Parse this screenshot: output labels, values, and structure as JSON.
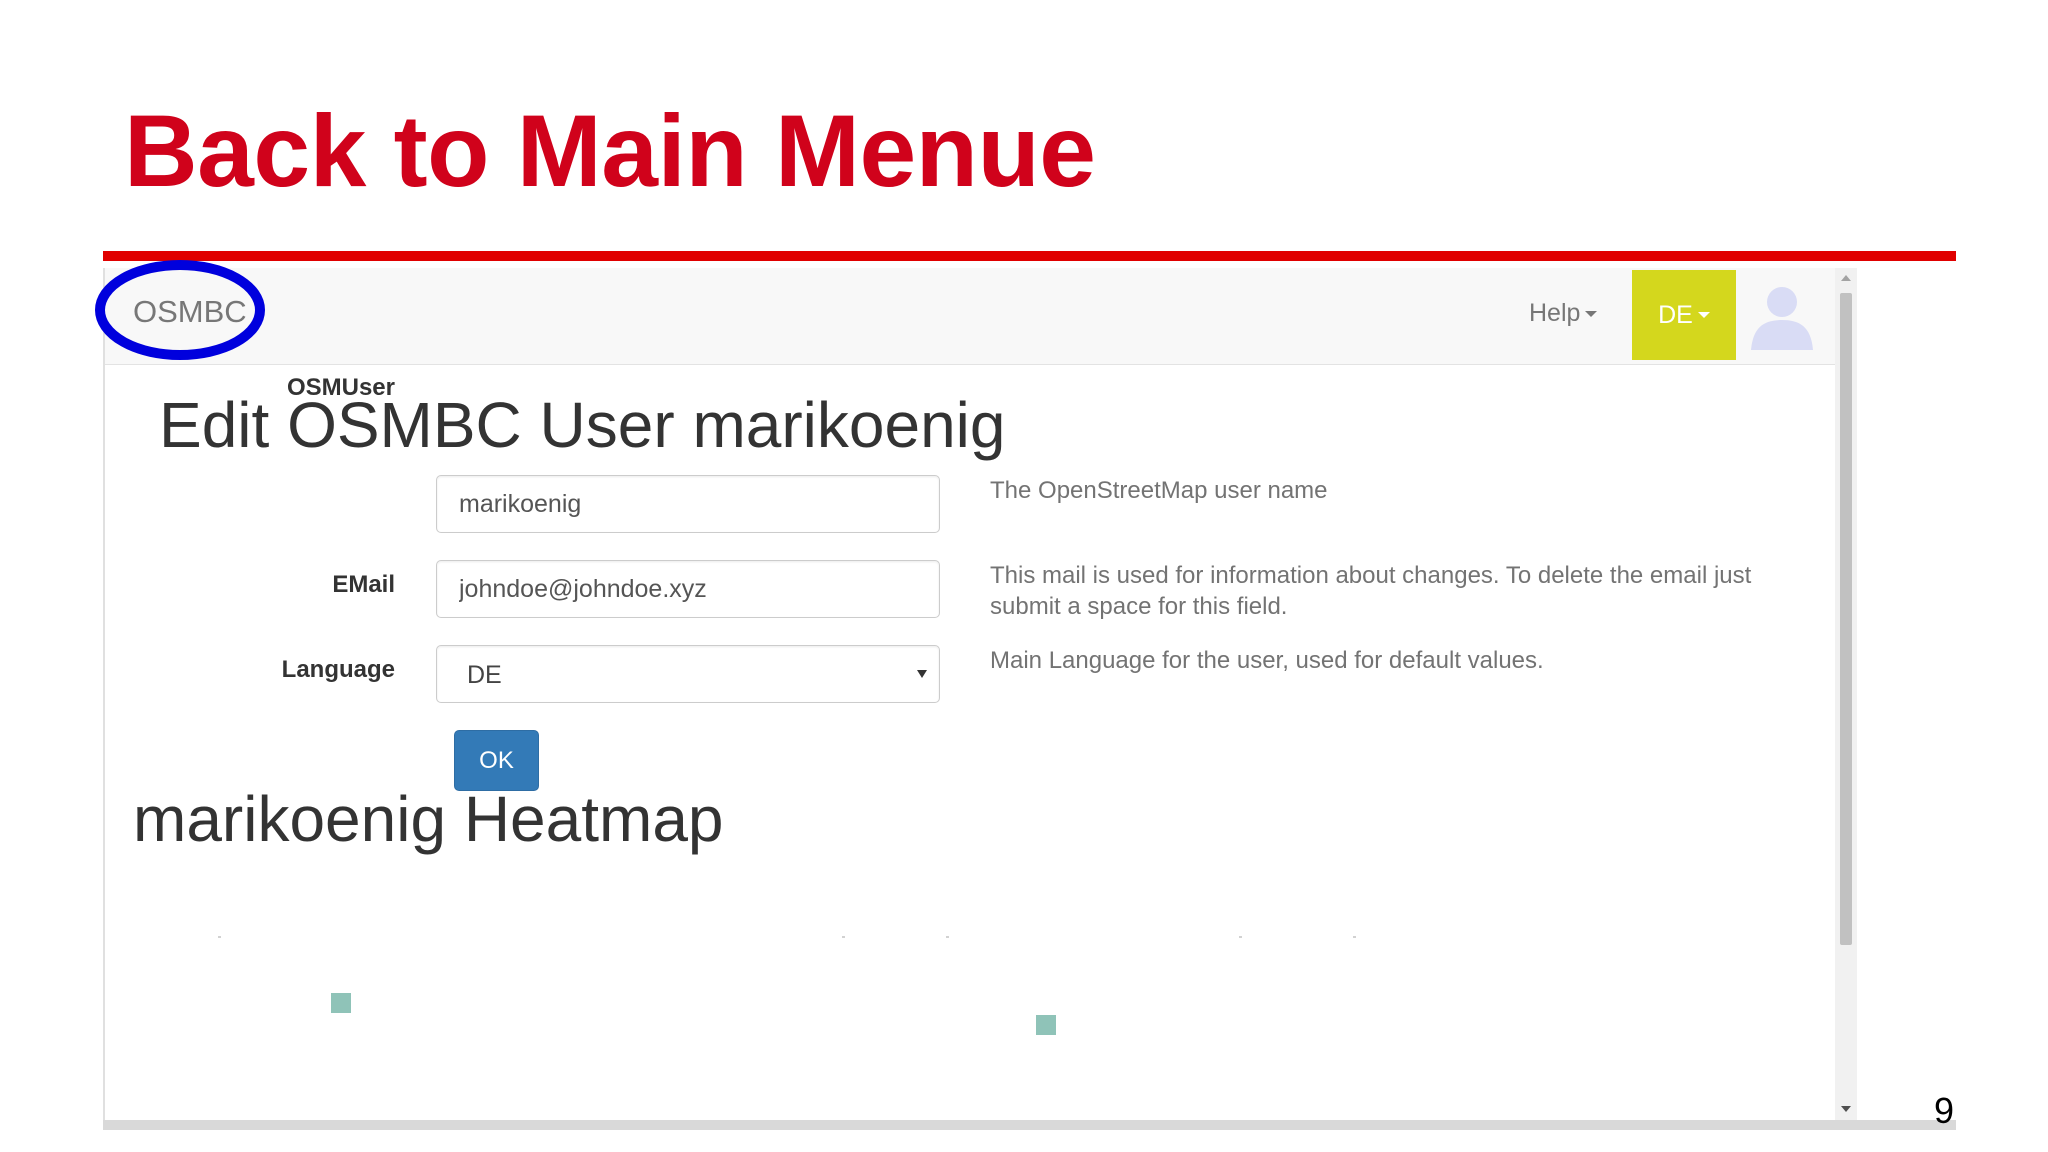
{
  "slide": {
    "title": "Back to Main Menue",
    "page_number": "9",
    "colors": {
      "title": "#d0021b",
      "rule": "#e00000",
      "annotation": "#0000dd"
    }
  },
  "app": {
    "navbar": {
      "brand": "OSMBC",
      "help_label": "Help",
      "language_label": "DE",
      "language_color": "#d4d71d",
      "avatar_icon": "user-silhouette-icon"
    },
    "heading": "Edit OSMBC User marikoenig",
    "form": {
      "fields": [
        {
          "label": "OSMUser",
          "value": "marikoenig",
          "help": "The OpenStreetMap user name"
        },
        {
          "label": "EMail",
          "value": "johndoe@johndoe.xyz",
          "help": "This mail is used for information about changes. To delete the email just submit a space for this field."
        },
        {
          "label": "Language",
          "value": "DE",
          "help": "Main Language for the user, used for default values."
        }
      ],
      "ok_label": "OK",
      "ok_color": "#337ab7"
    },
    "heatmap_heading": "marikoenig Heatmap",
    "heatmap_color": "#8fc3b8"
  }
}
